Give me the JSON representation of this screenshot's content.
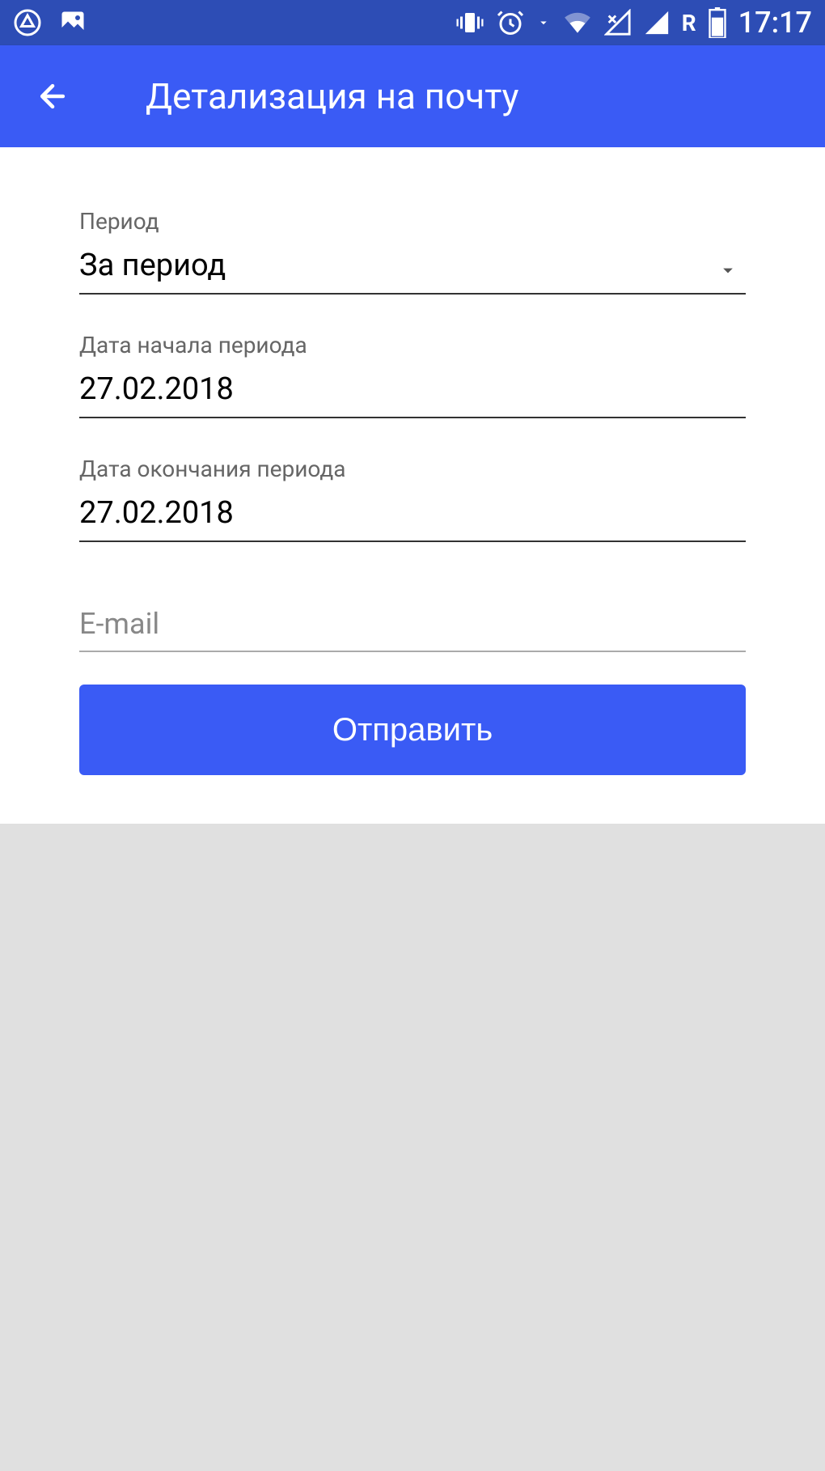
{
  "status_bar": {
    "time": "17:17",
    "roaming": "R"
  },
  "header": {
    "title": "Детализация на почту"
  },
  "form": {
    "period_label": "Период",
    "period_value": "За период",
    "start_date_label": "Дата начала периода",
    "start_date_value": "27.02.2018",
    "end_date_label": "Дата окончания периода",
    "end_date_value": "27.02.2018",
    "email_placeholder": "E-mail",
    "email_value": "",
    "submit_label": "Отправить"
  }
}
